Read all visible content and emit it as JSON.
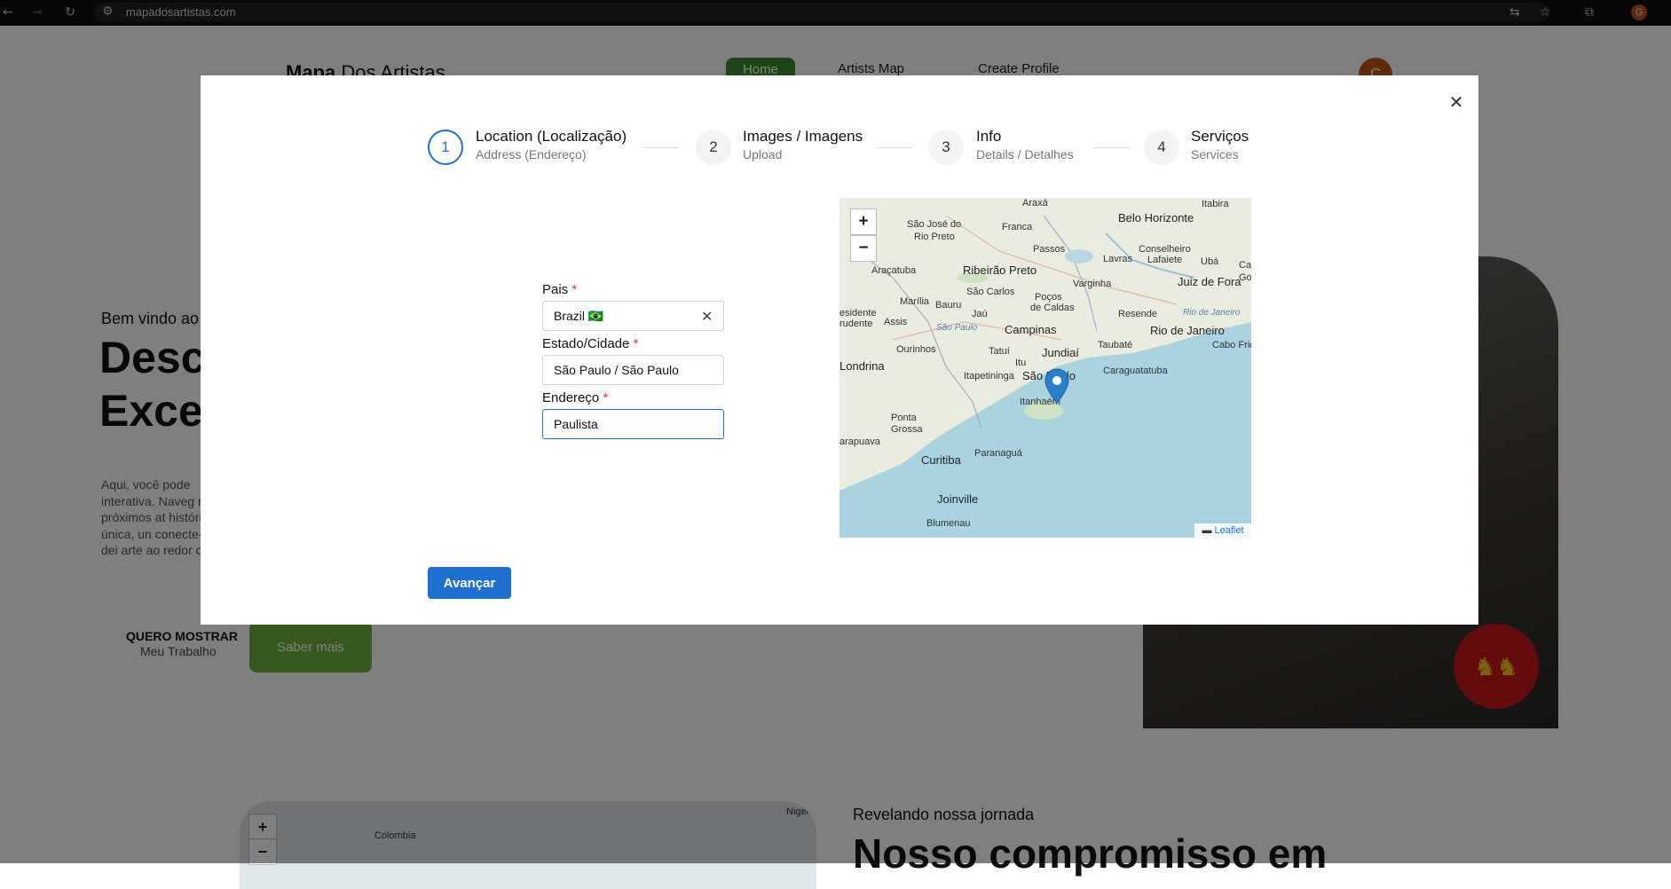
{
  "browser": {
    "url": "mapadosartistas.com",
    "avatar_letter": "G"
  },
  "background_page": {
    "logo_bold": "Mapa",
    "logo_rest": "Dos Artistas",
    "nav": [
      "Home",
      "Artists Map",
      "Create Profile"
    ],
    "avatar_letter": "C",
    "welcome": "Bem vindo ao",
    "headline_line1": "Desc",
    "headline_line2": "Exce",
    "paragraph": "Aqui, você pode interativa. Naveg mais próximos at história única, un conecte-se e dei arte ao redor do",
    "cta_title": "QUERO MOSTRAR",
    "cta_subtitle": "Meu Trabalho",
    "cta_button": "Saber mais",
    "map_labels": [
      "Colombia",
      "Niger"
    ],
    "section_kicker": "Revelando nossa jornada",
    "section_title": "Nosso compromisso em"
  },
  "modal": {
    "close_symbol": "✕",
    "steps": [
      {
        "number": "1",
        "title": "Location (Localização)",
        "subtitle": "Address (Endereço)",
        "active": true
      },
      {
        "number": "2",
        "title": "Images / Imagens",
        "subtitle": "Upload",
        "active": false
      },
      {
        "number": "3",
        "title": "Info",
        "subtitle": "Details / Detalhes",
        "active": false
      },
      {
        "number": "4",
        "title": "Serviços",
        "subtitle": "Services",
        "active": false
      }
    ],
    "form": {
      "country_label": "Pais",
      "country_value": "Brazil 🇧🇷",
      "state_city_label": "Estado/Cidade",
      "state_city_value": "São Paulo / São Paulo",
      "address_label": "Endereço",
      "address_value": "Paulista",
      "required_mark": "*"
    },
    "next_button": "Avançar",
    "map": {
      "zoom_in": "+",
      "zoom_out": "−",
      "attribution": "Leaflet",
      "cities": [
        "Araxá",
        "Itabira",
        "São José do",
        "Rio Preto",
        "Franca",
        "Belo Horizonte",
        "Passos",
        "Conselheiro",
        "Lafaiete",
        "Lavras",
        "Ubá",
        "Cam",
        "Goy",
        "Araçatuba",
        "Ribeirão Preto",
        "Varginha",
        "Juiz de Fora",
        "São Carlos",
        "Poços",
        "de Caldas",
        "Marília",
        "Bauru",
        "Jaú",
        "Resende",
        "Rio de Janeiro",
        "esidente",
        "rudente",
        "Assis",
        "São Paulo",
        "Campinas",
        "Taubaté",
        "Rio de Janeiro",
        "Cabo Frio",
        "Ourinhos",
        "Tatuí",
        "Jundiaí",
        "Londrina",
        "Itu",
        "Itapetininga",
        "São Paulo",
        "Caraguatatuba",
        "Itanhaém",
        "Ponta",
        "Grossa",
        "arapuava",
        "Paranaguá",
        "Curitiba",
        "Joinville",
        "Blumenau"
      ]
    }
  },
  "colors": {
    "accent": "#1f6fd1",
    "required": "#e03131",
    "overlay": "rgba(0,0,0,0.5)",
    "green": "#3b8a2a"
  }
}
